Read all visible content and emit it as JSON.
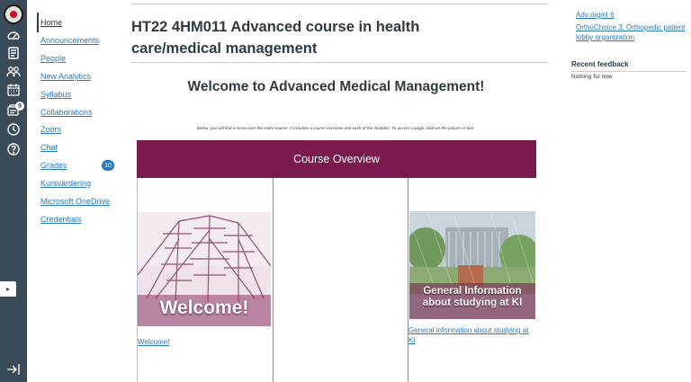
{
  "global_nav": {
    "items": [
      {
        "icon": "institution-logo-icon"
      },
      {
        "icon": "dashboard-icon"
      },
      {
        "icon": "courses-icon"
      },
      {
        "icon": "groups-icon"
      },
      {
        "icon": "calendar-icon"
      },
      {
        "icon": "inbox-icon",
        "badge": "9"
      },
      {
        "icon": "history-icon"
      },
      {
        "icon": "help-icon"
      }
    ],
    "tray_toggle": "▸",
    "collapse_icon": "collapse-nav-icon"
  },
  "course_nav": {
    "items": [
      {
        "label": "Home",
        "active": true
      },
      {
        "label": "Announcements"
      },
      {
        "label": "People"
      },
      {
        "label": "New Analytics"
      },
      {
        "label": "Syllabus"
      },
      {
        "label": "Collaborations"
      },
      {
        "label": "Zoom"
      },
      {
        "label": "Chat"
      },
      {
        "label": "Grades",
        "count": "10"
      },
      {
        "label": "Kursvärdering"
      },
      {
        "label": "Microsoft OneDrive"
      },
      {
        "label": "Credentials"
      }
    ]
  },
  "main": {
    "course_title": "HT22 4HM011 Advanced course in health care/medical management",
    "welcome_heading": "Welcome to Advanced Medical Management!",
    "intro_text": "Below, you will find a menu over the entire course. It includes a course overview and each of the modules.  To access a page, click on the picture or text.",
    "banner": "Course Overview",
    "cards": [
      {
        "image_caption": "Welcome!",
        "link": "Welcome!"
      },
      {
        "image_caption": "General Information about studying at KI",
        "link": "General information about studying at KI"
      }
    ]
  },
  "sidebar": {
    "todo_links": [
      "Adv mgmt 6",
      "OrthoChoice 3: Orthopedic patient lobby organization"
    ],
    "recent_feedback_heading": "Recent feedback",
    "recent_feedback_empty": "Nothing for now"
  },
  "colors": {
    "rail": "#394b58",
    "banner": "#7b1a4c",
    "link": "#2b7abc",
    "text": "#2d3b45"
  }
}
